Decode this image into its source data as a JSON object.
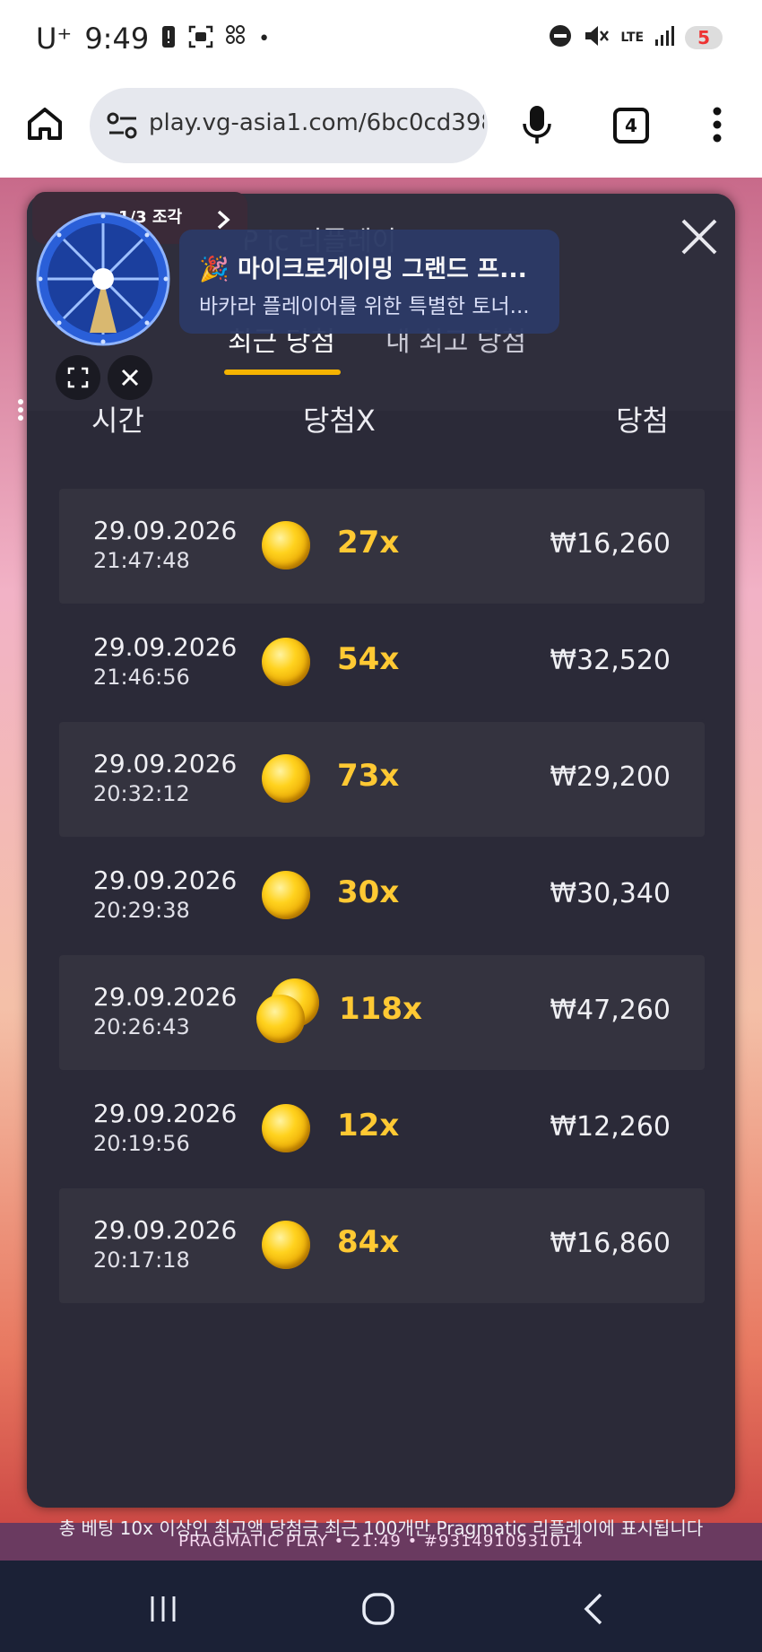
{
  "status_bar": {
    "carrier": "U⁺",
    "time": "9:49",
    "network": "LTE",
    "battery": "5"
  },
  "browser": {
    "url": "play.vg-asia1.com/6bc0cd398",
    "tab_count": "4"
  },
  "notification": {
    "emoji": "🎉",
    "title": "마이크로게이밍 그랜드 프...",
    "subtitle": "바카라 플레이어를 위한 특별한 토너..."
  },
  "widget": {
    "pieces": "1/3 조각"
  },
  "modal": {
    "title_partial": "P       ic  리플레이",
    "tabs": [
      {
        "label": "최근 당첨",
        "active": true
      },
      {
        "label": "내 최고 당첨",
        "active": false
      }
    ],
    "columns": {
      "time": "시간",
      "multiplier": "당첨X",
      "win": "당첨"
    },
    "rows": [
      {
        "date": "29.09.2026",
        "time": "21:47:48",
        "multiplier": "27x",
        "win": "₩16,260",
        "coins": 1
      },
      {
        "date": "29.09.2026",
        "time": "21:46:56",
        "multiplier": "54x",
        "win": "₩32,520",
        "coins": 1
      },
      {
        "date": "29.09.2026",
        "time": "20:32:12",
        "multiplier": "73x",
        "win": "₩29,200",
        "coins": 1
      },
      {
        "date": "29.09.2026",
        "time": "20:29:38",
        "multiplier": "30x",
        "win": "₩30,340",
        "coins": 1
      },
      {
        "date": "29.09.2026",
        "time": "20:26:43",
        "multiplier": "118x",
        "win": "₩47,260",
        "coins": 2
      },
      {
        "date": "29.09.2026",
        "time": "20:19:56",
        "multiplier": "12x",
        "win": "₩12,260",
        "coins": 1
      },
      {
        "date": "29.09.2026",
        "time": "20:17:18",
        "multiplier": "84x",
        "win": "₩16,860",
        "coins": 1
      }
    ],
    "footer_note": "총 베팅 10x 이상인 최고액 당첨금 최근 100개만 Pragmatic 리플레이에 표시됩니다"
  },
  "game_footer": "PRAGMATIC PLAY • 21:49 • #9314910931014",
  "colors": {
    "accent": "#f5b300",
    "multiplier": "#ffc933",
    "modal_bg": "#2b2a38",
    "row_bg": "#34333f",
    "navbar": "#1b2136"
  }
}
